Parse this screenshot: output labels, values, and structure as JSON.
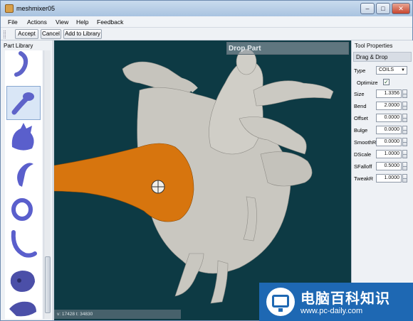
{
  "window": {
    "title": "meshmixer05"
  },
  "menu": [
    "File",
    "Actions",
    "View",
    "Help",
    "Feedback"
  ],
  "toolbar": {
    "accept_label": "Accept",
    "cancel_label": "Cancel",
    "add_library_label": "Add to Library"
  },
  "part_library": {
    "title": "Part Library",
    "items": [
      "curved-tube",
      "arm-part",
      "creature-head",
      "horn",
      "ring",
      "tail",
      "skull",
      "dragon-head"
    ],
    "selected_index": 1
  },
  "viewport": {
    "drop_label": "Drop Part",
    "status_text": "v: 17428  t: 34830",
    "background": "#0d3a44",
    "mesh_color": "#c6c4bd",
    "highlight_color": "#d7750e"
  },
  "tool_properties": {
    "title": "Tool Properties",
    "section": "Drag & Drop",
    "type_label": "Type",
    "type_value": "COILS",
    "optimize_label": "Optimize",
    "optimize_checked": true,
    "fields": [
      {
        "label": "Size",
        "value": "1.3356"
      },
      {
        "label": "Bend",
        "value": "2.0000"
      },
      {
        "label": "Offset",
        "value": "0.0000"
      },
      {
        "label": "Bulge",
        "value": "0.0000"
      },
      {
        "label": "SmoothR",
        "value": "0.0000"
      },
      {
        "label": "DScale",
        "value": "1.0000"
      },
      {
        "label": "SFalloff",
        "value": "0.5000"
      },
      {
        "label": "TweakR",
        "value": "1.0000"
      }
    ]
  },
  "watermark": {
    "title": "电脑百科知识",
    "url": "www.pc-daily.com"
  }
}
